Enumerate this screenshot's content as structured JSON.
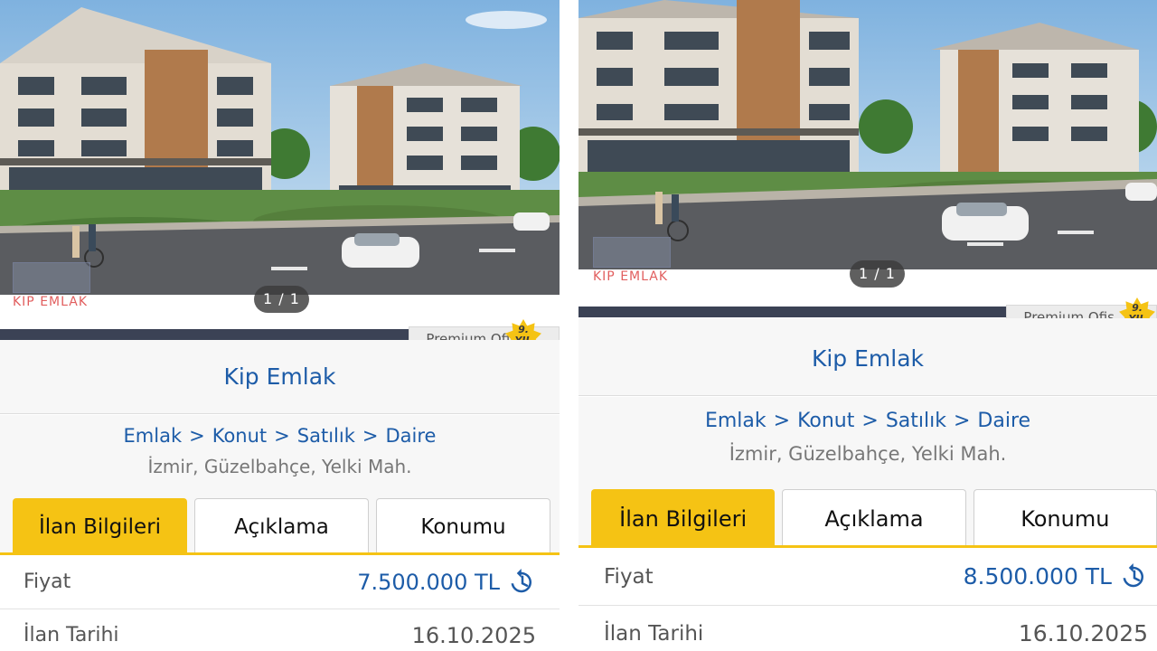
{
  "panels": [
    {
      "photo": {
        "counter": "1 / 1",
        "watermark": "KIP EMLAK"
      },
      "premium": {
        "label": "Premium Ofis",
        "years": "9.",
        "years_unit": "YIL"
      },
      "store_name": "Kip Emlak",
      "breadcrumb": [
        "Emlak",
        "Konut",
        "Satılık",
        "Daire"
      ],
      "breadcrumb_separator": ">",
      "location": "İzmir, Güzelbahçe, Yelki Mah.",
      "tabs": [
        {
          "label": "İlan Bilgileri",
          "active": true
        },
        {
          "label": "Açıklama",
          "active": false
        },
        {
          "label": "Konumu",
          "active": false
        }
      ],
      "info": [
        {
          "key": "Fiyat",
          "value": "7.500.000 TL",
          "icon": "history-icon"
        },
        {
          "key": "İlan Tarihi",
          "value": "16.10.2025"
        }
      ]
    },
    {
      "photo": {
        "counter": "1 / 1",
        "watermark": "KIP EMLAK"
      },
      "premium": {
        "label": "Premium Ofis",
        "years": "9.",
        "years_unit": "YIL"
      },
      "store_name": "Kip Emlak",
      "breadcrumb": [
        "Emlak",
        "Konut",
        "Satılık",
        "Daire"
      ],
      "breadcrumb_separator": ">",
      "location": "İzmir, Güzelbahçe, Yelki Mah.",
      "tabs": [
        {
          "label": "İlan Bilgileri",
          "active": true
        },
        {
          "label": "Açıklama",
          "active": false
        },
        {
          "label": "Konumu",
          "active": false
        }
      ],
      "info": [
        {
          "key": "Fiyat",
          "value": "8.500.000 TL",
          "icon": "history-icon"
        },
        {
          "key": "İlan Tarihi",
          "value": "16.10.2025"
        }
      ]
    }
  ],
  "colors": {
    "accent_yellow": "#f5c314",
    "link_blue": "#1d5ca8",
    "band_dark": "#3b4255"
  }
}
